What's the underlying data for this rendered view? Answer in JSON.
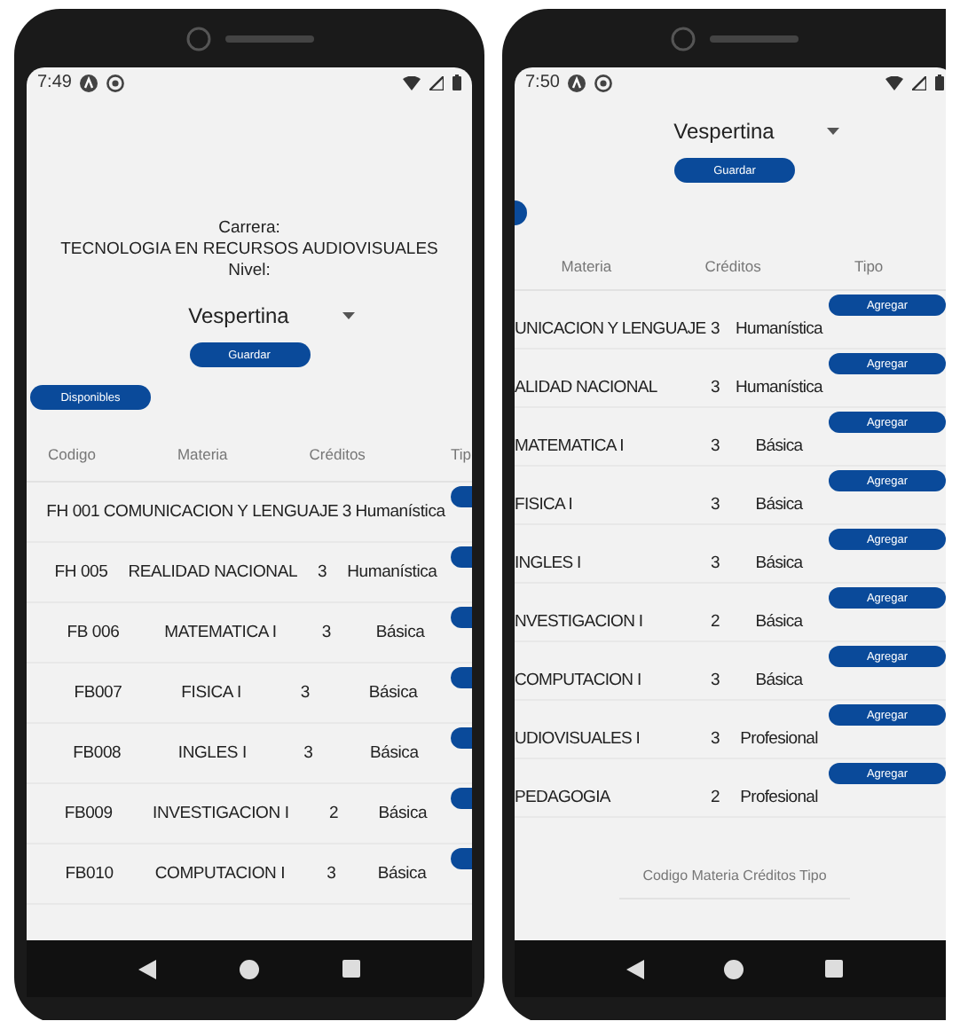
{
  "left_phone": {
    "status_time": "7:49",
    "carrera_label": "Carrera:",
    "carrera": "TECNOLOGIA EN RECURSOS AUDIOVISUALES",
    "nivel_label": "Nivel:",
    "nivel_select": "Vespertina",
    "save_button": "Guardar",
    "tab_button": "Disponibles",
    "table": {
      "columns": [
        "Codigo",
        "Materia",
        "Créditos",
        "Tip"
      ],
      "rows": [
        {
          "codigo": "FH 001",
          "materia": "COMUNICACION Y LENGUAJE",
          "creditos": "3",
          "tipo": "Humanística"
        },
        {
          "codigo": "FH 005",
          "materia": "REALIDAD NACIONAL",
          "creditos": "3",
          "tipo": "Humanística"
        },
        {
          "codigo": "FB 006",
          "materia": "MATEMATICA I",
          "creditos": "3",
          "tipo": "Básica"
        },
        {
          "codigo": "FB007",
          "materia": "FISICA I",
          "creditos": "3",
          "tipo": "Básica"
        },
        {
          "codigo": "FB008",
          "materia": "INGLES I",
          "creditos": "3",
          "tipo": "Básica"
        },
        {
          "codigo": "FB009",
          "materia": "INVESTIGACION I",
          "creditos": "2",
          "tipo": "Básica"
        },
        {
          "codigo": "FB010",
          "materia": "COMPUTACION I",
          "creditos": "3",
          "tipo": "Básica"
        }
      ]
    }
  },
  "right_phone": {
    "status_time": "7:50",
    "nivel_select": "Vespertina",
    "save_button": "Guardar",
    "table": {
      "columns": [
        "Materia",
        "Créditos",
        "Tipo"
      ],
      "rows": [
        {
          "materia": "UNICACION Y LENGUAJE",
          "creditos": "3",
          "tipo": "Humanística",
          "action": "Agregar"
        },
        {
          "materia": "ALIDAD NACIONAL",
          "creditos": "3",
          "tipo": "Humanística",
          "action": "Agregar"
        },
        {
          "materia": "MATEMATICA I",
          "creditos": "3",
          "tipo": "Básica",
          "action": "Agregar"
        },
        {
          "materia": "FISICA I",
          "creditos": "3",
          "tipo": "Básica",
          "action": "Agregar"
        },
        {
          "materia": "INGLES I",
          "creditos": "3",
          "tipo": "Básica",
          "action": "Agregar"
        },
        {
          "materia": "NVESTIGACION I",
          "creditos": "2",
          "tipo": "Básica",
          "action": "Agregar"
        },
        {
          "materia": "COMPUTACION I",
          "creditos": "3",
          "tipo": "Básica",
          "action": "Agregar"
        },
        {
          "materia": "UDIOVISUALES I",
          "creditos": "3",
          "tipo": "Profesional",
          "action": "Agregar"
        },
        {
          "materia": "PEDAGOGIA",
          "creditos": "2",
          "tipo": "Profesional",
          "action": "Agregar"
        }
      ]
    },
    "footer": "Codigo Materia Créditos Tipo"
  }
}
